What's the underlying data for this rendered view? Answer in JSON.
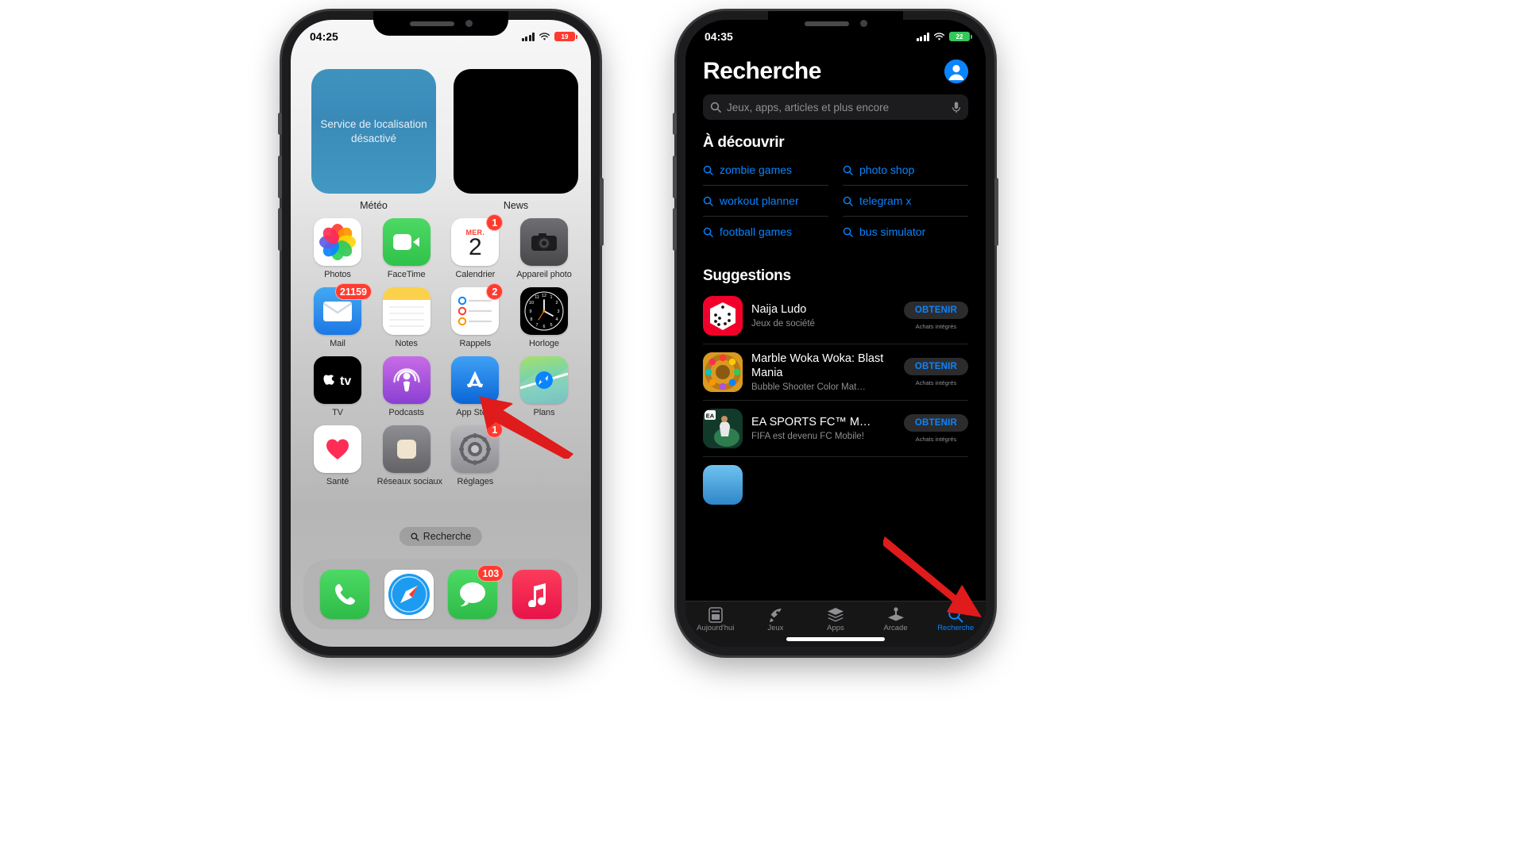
{
  "left_phone": {
    "statusbar": {
      "time": "04:25",
      "battery": "19",
      "signal_icon": "cellular-bars-icon",
      "wifi_icon": "wifi-icon",
      "battery_icon": "battery-icon"
    },
    "widgets": [
      {
        "name": "Météo",
        "text": "Service de localisation désactivé",
        "kind": "weather"
      },
      {
        "name": "News",
        "text": "",
        "kind": "news"
      }
    ],
    "rows": [
      [
        {
          "label": "Photos",
          "icon": "photos-icon",
          "badge": null
        },
        {
          "label": "FaceTime",
          "icon": "facetime-icon",
          "badge": null
        },
        {
          "label": "Calendrier",
          "icon": "calendar-icon",
          "badge": "1",
          "cal_day": "MER.",
          "cal_num": "2"
        },
        {
          "label": "Appareil photo",
          "icon": "camera-icon",
          "badge": null
        }
      ],
      [
        {
          "label": "Mail",
          "icon": "mail-icon",
          "badge": "21159"
        },
        {
          "label": "Notes",
          "icon": "notes-icon",
          "badge": null
        },
        {
          "label": "Rappels",
          "icon": "reminders-icon",
          "badge": "2"
        },
        {
          "label": "Horloge",
          "icon": "clock-icon",
          "badge": null
        }
      ],
      [
        {
          "label": "TV",
          "icon": "tv-icon",
          "badge": null
        },
        {
          "label": "Podcasts",
          "icon": "podcasts-icon",
          "badge": null
        },
        {
          "label": "App Store",
          "icon": "appstore-icon",
          "badge": null
        },
        {
          "label": "Plans",
          "icon": "maps-icon",
          "badge": null
        }
      ],
      [
        {
          "label": "Santé",
          "icon": "health-icon",
          "badge": null
        },
        {
          "label": "Réseaux sociaux",
          "icon": "social-folder-icon",
          "badge": null
        },
        {
          "label": "Réglages",
          "icon": "settings-icon",
          "badge": "1"
        },
        {
          "label": "",
          "icon": "",
          "badge": null
        }
      ]
    ],
    "search_pill": {
      "label": "Recherche",
      "icon": "search-icon"
    },
    "dock": [
      {
        "label": "Téléphone",
        "icon": "phone-icon",
        "badge": null
      },
      {
        "label": "Safari",
        "icon": "safari-icon",
        "badge": null
      },
      {
        "label": "Messages",
        "icon": "messages-icon",
        "badge": "103"
      },
      {
        "label": "Musique",
        "icon": "music-icon",
        "badge": null
      }
    ]
  },
  "right_phone": {
    "statusbar": {
      "time": "04:35",
      "battery": "22",
      "signal_icon": "cellular-bars-icon",
      "wifi_icon": "wifi-icon",
      "battery_icon": "battery-icon"
    },
    "title": "Recherche",
    "avatar_icon": "account-avatar-icon",
    "search": {
      "placeholder": "Jeux, apps, articles et plus encore",
      "icon": "search-icon",
      "mic_icon": "microphone-icon"
    },
    "discover_heading": "À découvrir",
    "discover": [
      "zombie games",
      "photo shop",
      "workout planner",
      "telegram x",
      "football games",
      "bus simulator"
    ],
    "suggestions_heading": "Suggestions",
    "suggestions": [
      {
        "name": "Naija Ludo",
        "subtitle": "Jeux de société",
        "button": "OBTENIR",
        "note": "Achats intégrés",
        "icon": "naija-ludo-dice-icon"
      },
      {
        "name": "Marble Woka Woka: Blast Mania",
        "subtitle": "Bubble Shooter Color Mat…",
        "button": "OBTENIR",
        "note": "Achats intégrés",
        "icon": "marble-woka-woka-icon"
      },
      {
        "name": "EA SPORTS FC™ M…",
        "subtitle": "FIFA est devenu FC Mobile!",
        "button": "OBTENIR",
        "note": "Achats intégrés",
        "icon": "ea-sports-fc-icon"
      }
    ],
    "tabs": [
      {
        "label": "Aujourd'hui",
        "icon": "today-icon",
        "active": false
      },
      {
        "label": "Jeux",
        "icon": "rocket-icon",
        "active": false
      },
      {
        "label": "Apps",
        "icon": "stack-icon",
        "active": false
      },
      {
        "label": "Arcade",
        "icon": "joystick-icon",
        "active": false
      },
      {
        "label": "Recherche",
        "icon": "search-icon",
        "active": true
      }
    ]
  },
  "annotations": {
    "arrow_color": "#e01b1b",
    "arrows": [
      {
        "target": "App Store app icon on home screen"
      },
      {
        "target": "Recherche tab in App Store tab bar"
      }
    ]
  }
}
